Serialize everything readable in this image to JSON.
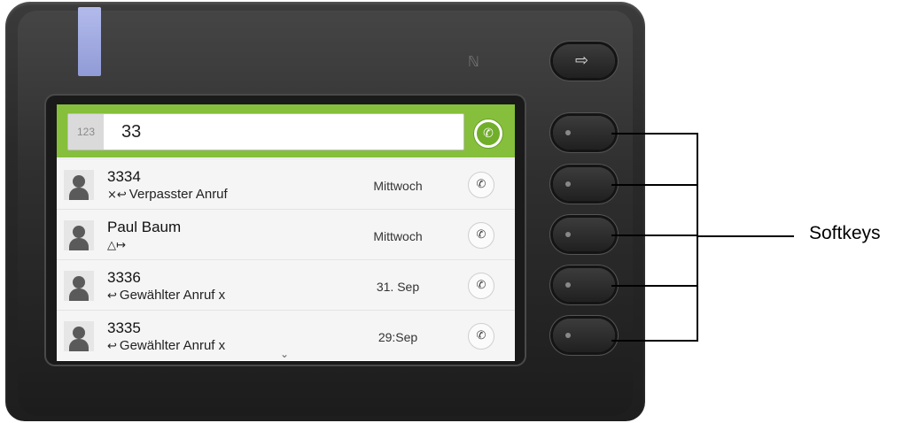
{
  "device": {
    "exit_icon": "exit-icon",
    "nfc_icon": "nfc-icon"
  },
  "dial": {
    "prefix": "123",
    "value": "33",
    "call_icon": "phone-icon"
  },
  "entries": [
    {
      "name": "3334",
      "type": "Verpasster Anruf",
      "type_icon": "×↩",
      "date": "Mittwoch"
    },
    {
      "name": "Paul Baum",
      "type": "",
      "type_icon": "△↦",
      "date": "Mittwoch"
    },
    {
      "name": "3336",
      "type": "Gewählter Anruf x",
      "type_icon": "↩",
      "date": "31. Sep"
    },
    {
      "name": "3335",
      "type": "Gewählter Anruf x",
      "type_icon": "↩",
      "date": "29:Sep"
    }
  ],
  "annotation": {
    "softkeys_label": "Softkeys"
  },
  "colors": {
    "accent_green": "#86bf3b",
    "led_blue": "#a9b3f0"
  }
}
